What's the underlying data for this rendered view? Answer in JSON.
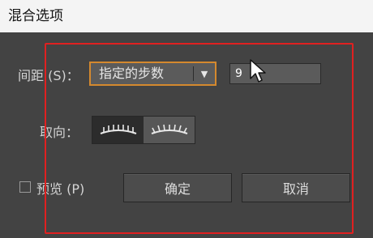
{
  "window": {
    "title": "混合选项"
  },
  "spacing": {
    "label": "间距 (S)：",
    "mode_value": "指定的步数",
    "dropdown_icon": "triangle-down-icon",
    "steps_value": "9"
  },
  "orientation": {
    "label": "取向：",
    "options": [
      {
        "icon": "align-to-page-icon",
        "selected": true
      },
      {
        "icon": "align-to-path-icon",
        "selected": false
      }
    ]
  },
  "preview": {
    "label": "预览 (P)",
    "checked": false
  },
  "buttons": {
    "ok_label": "确定",
    "cancel_label": "取消"
  },
  "colors": {
    "dialog_background": "#434343",
    "focus_outline": "#d4892e",
    "annotation_box": "#e02020"
  }
}
